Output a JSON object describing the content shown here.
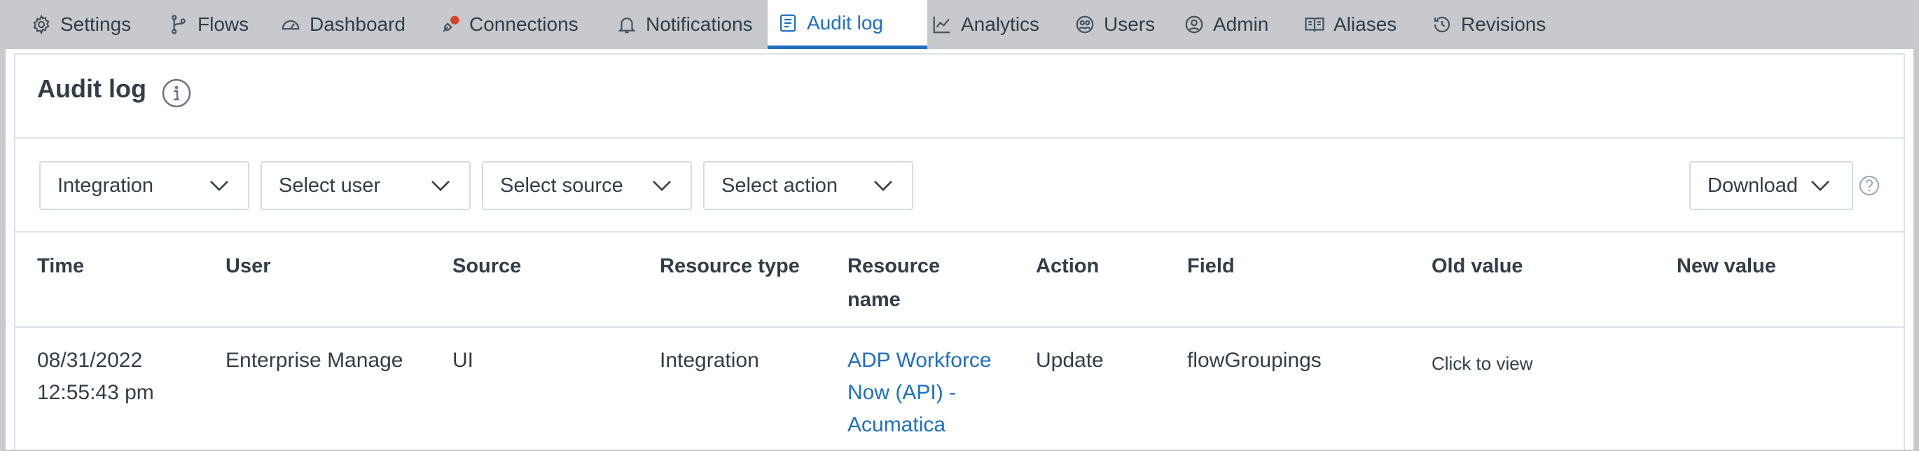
{
  "tabs": [
    {
      "label": "Settings",
      "icon": "gear-icon"
    },
    {
      "label": "Flows",
      "icon": "flows-icon"
    },
    {
      "label": "Dashboard",
      "icon": "dashboard-gauge-icon"
    },
    {
      "label": "Connections",
      "icon": "connections-plug-icon"
    },
    {
      "label": "Notifications",
      "icon": "bell-icon"
    },
    {
      "label": "Audit log",
      "icon": "audit-log-icon",
      "active": true
    },
    {
      "label": "Analytics",
      "icon": "line-chart-icon"
    },
    {
      "label": "Users",
      "icon": "users-icon"
    },
    {
      "label": "Admin",
      "icon": "admin-user-icon"
    },
    {
      "label": "Aliases",
      "icon": "book-icon"
    },
    {
      "label": "Revisions",
      "icon": "history-clock-icon"
    }
  ],
  "page": {
    "title": "Audit log"
  },
  "filters": {
    "resource_type": "Integration",
    "user": "Select user",
    "source": "Select source",
    "action": "Select action",
    "download": "Download"
  },
  "table": {
    "headers": [
      "Time",
      "User",
      "Source",
      "Resource type",
      "Resource name",
      "Action",
      "Field",
      "Old value",
      "New value"
    ],
    "rows": [
      {
        "time_date": "08/31/2022",
        "time_clock": "12:55:43 pm",
        "user": "Enterprise Manage",
        "source": "UI",
        "resource_type": "Integration",
        "resource_name_1": "ADP Workforce",
        "resource_name_2": "Now (API) -",
        "resource_name_3": "Acumatica",
        "action": "Update",
        "field": "flowGroupings",
        "old_value": "Click to view",
        "new_value": ""
      }
    ]
  },
  "colors": {
    "accent": "#1f6fc1",
    "tab_bar": "#c7c9cc",
    "border": "#dbe3ea",
    "text": "#333d47"
  }
}
